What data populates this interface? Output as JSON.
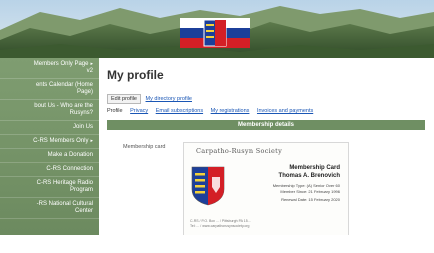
{
  "sidebar": {
    "items": [
      {
        "label": "Members Only Page",
        "sub": "v2",
        "arrow": "▸"
      },
      {
        "label": "ents Calendar (Home",
        "sub": "Page)",
        "arrow": ""
      },
      {
        "label": "bout Us - Who are the",
        "sub": "Rusyns?",
        "arrow": ""
      },
      {
        "label": "Join Us",
        "sub": "",
        "arrow": ""
      },
      {
        "label": "C-RS Members Only",
        "sub": "",
        "arrow": "▸"
      },
      {
        "label": "Make a Donation",
        "sub": "",
        "arrow": ""
      },
      {
        "label": "C-RS Connection",
        "sub": "",
        "arrow": ""
      },
      {
        "label": "C-RS Heritage Radio",
        "sub": "Program",
        "arrow": ""
      },
      {
        "label": "-RS National Cultural",
        "sub": "Center",
        "arrow": ""
      }
    ]
  },
  "main": {
    "title": "My profile",
    "edit_profile_button": "Edit profile",
    "directory_profile_link": "My directory profile",
    "tabs_label": "Profile",
    "tabs": [
      "Privacy",
      "Email subscriptions",
      "My registrations",
      "Invoices and payments"
    ],
    "section_title": "Membership details",
    "membership_card_label": "Membership card"
  },
  "card": {
    "org_name": "Carpatho-Rusyn Society",
    "heading": "Membership Card",
    "member_name": "Thomas A. Brenovich",
    "lines": [
      "Membership Type: (A) Senior Over 60",
      "Member Since: 21 February 1996",
      "Renewal Date: 15 February 2020"
    ],
    "footer_lines": [
      "C-RS / P.O. Box ... / Pittsburgh PA 15...",
      "Tel: ... / www.carpathorusynsociety.org"
    ]
  },
  "colors": {
    "sidebar_bg": "#7f9d71",
    "section_bar": "#6f8f63",
    "link": "#1a56b5",
    "flag_blue": "#1c3f9a",
    "flag_red": "#d31f26"
  }
}
